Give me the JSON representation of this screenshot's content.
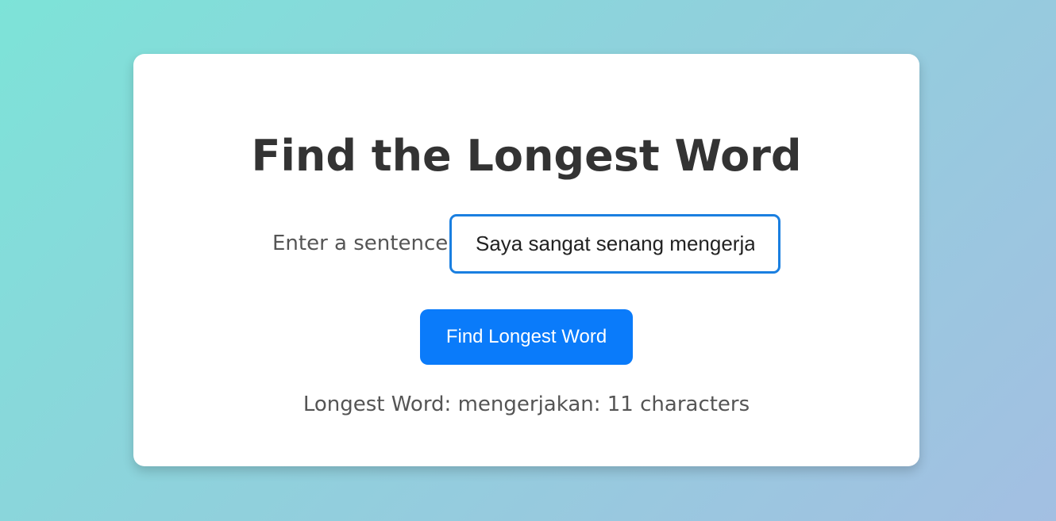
{
  "card": {
    "title": "Find the Longest Word",
    "input_label": "Enter a sentence:",
    "input_value": "Saya sangat senang mengerjakan",
    "button_label": "Find Longest Word",
    "result_text": "Longest Word: mengerjakan: 11 characters"
  },
  "colors": {
    "accent": "#0a7bfa",
    "input_border": "#1a7fe0",
    "title_text": "#333333",
    "body_text": "#555555"
  }
}
